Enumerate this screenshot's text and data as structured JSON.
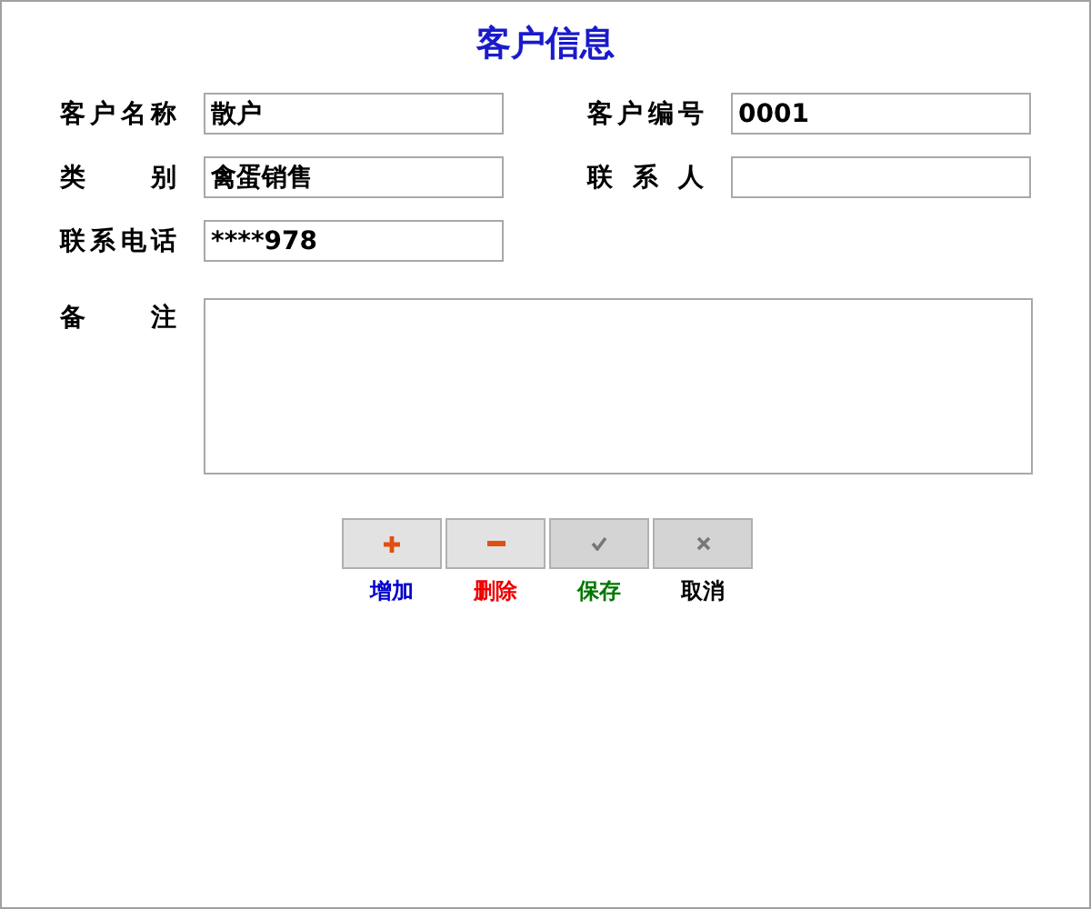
{
  "title": "客户信息",
  "fields": [
    {
      "label": "客户名称",
      "value": "散户"
    },
    {
      "label": "客户编号",
      "value": "0001"
    },
    {
      "label": "类 别",
      "value": "禽蛋销售"
    },
    {
      "label": "联 系 人"
    },
    {
      "label": "联系电话",
      "value": "****978"
    }
  ],
  "remarks": {
    "label": "备 注"
  },
  "actions": [
    {
      "kind": "add",
      "label": "增加",
      "color": "#0000cc",
      "disabled": false
    },
    {
      "kind": "delete",
      "label": "删除",
      "color": "#ee0000",
      "disabled": false
    },
    {
      "kind": "save",
      "label": "保存",
      "color": "#007700",
      "disabled": true
    },
    {
      "kind": "cancel",
      "label": "取消",
      "color": "#000000",
      "disabled": true
    }
  ]
}
